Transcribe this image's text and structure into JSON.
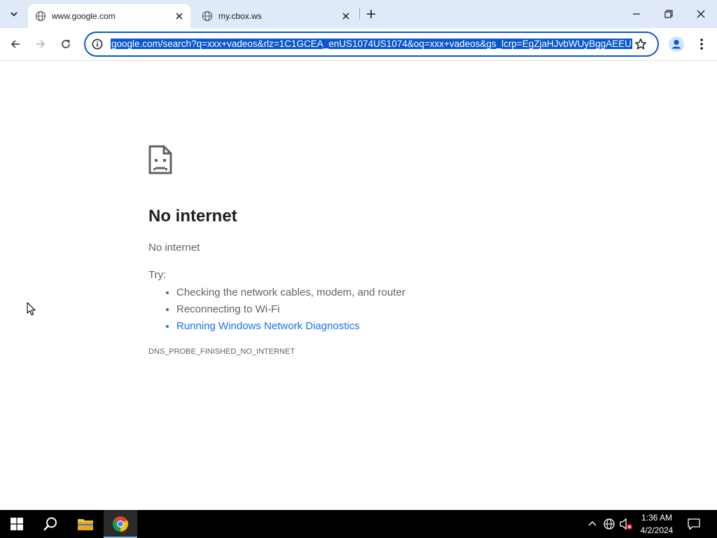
{
  "tabs": [
    {
      "title": "www.google.com",
      "active": true
    },
    {
      "title": "my.cbox.ws",
      "active": false
    }
  ],
  "address_bar": {
    "url": "google.com/search?q=xxx+vadeos&rlz=1C1GCEA_enUS1074US1074&oq=xxx+vadeos&gs_lcrp=EgZjaHJvbWUyBggAEEU"
  },
  "error_page": {
    "title": "No internet",
    "subtitle": "No internet",
    "try_label": "Try:",
    "suggestions": [
      "Checking the network cables, modem, and router",
      "Reconnecting to Wi-Fi",
      "Running Windows Network Diagnostics"
    ],
    "error_code": "DNS_PROBE_FINISHED_NO_INTERNET"
  },
  "taskbar": {
    "time": "1:36 AM",
    "date": "4/2/2024"
  },
  "colors": {
    "accent": "#0b57d0",
    "link": "#1a73e8",
    "tabstrip": "#dfe9f7"
  }
}
